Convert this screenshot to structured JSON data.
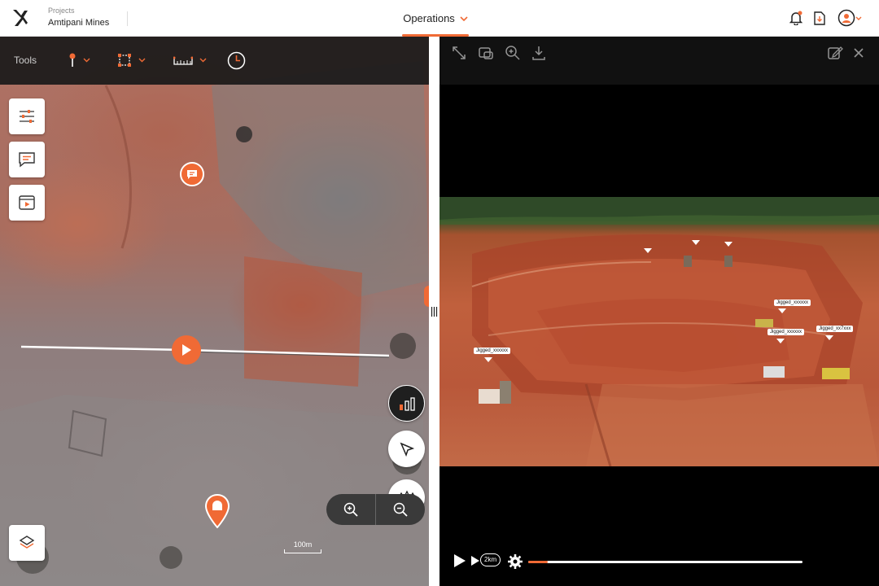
{
  "header": {
    "project_caption": "Projects",
    "project_name": "Amtipani Mines",
    "active_tab": "Operations"
  },
  "toolbar": {
    "tools_label": "Tools"
  },
  "map": {
    "scale_label": "100m"
  },
  "video": {
    "tags": [
      "Jigged_xxxxxx",
      "Jigged_xxxxxx",
      "Jigged_xx7xxx",
      "Jigged_xxxxxx"
    ],
    "speed_label": "2km",
    "progress": 0.07
  },
  "colors": {
    "accent": "#f06a35",
    "header_bg": "#ffffff",
    "toolbar_bg": "#191919",
    "video_bg": "#000000"
  }
}
